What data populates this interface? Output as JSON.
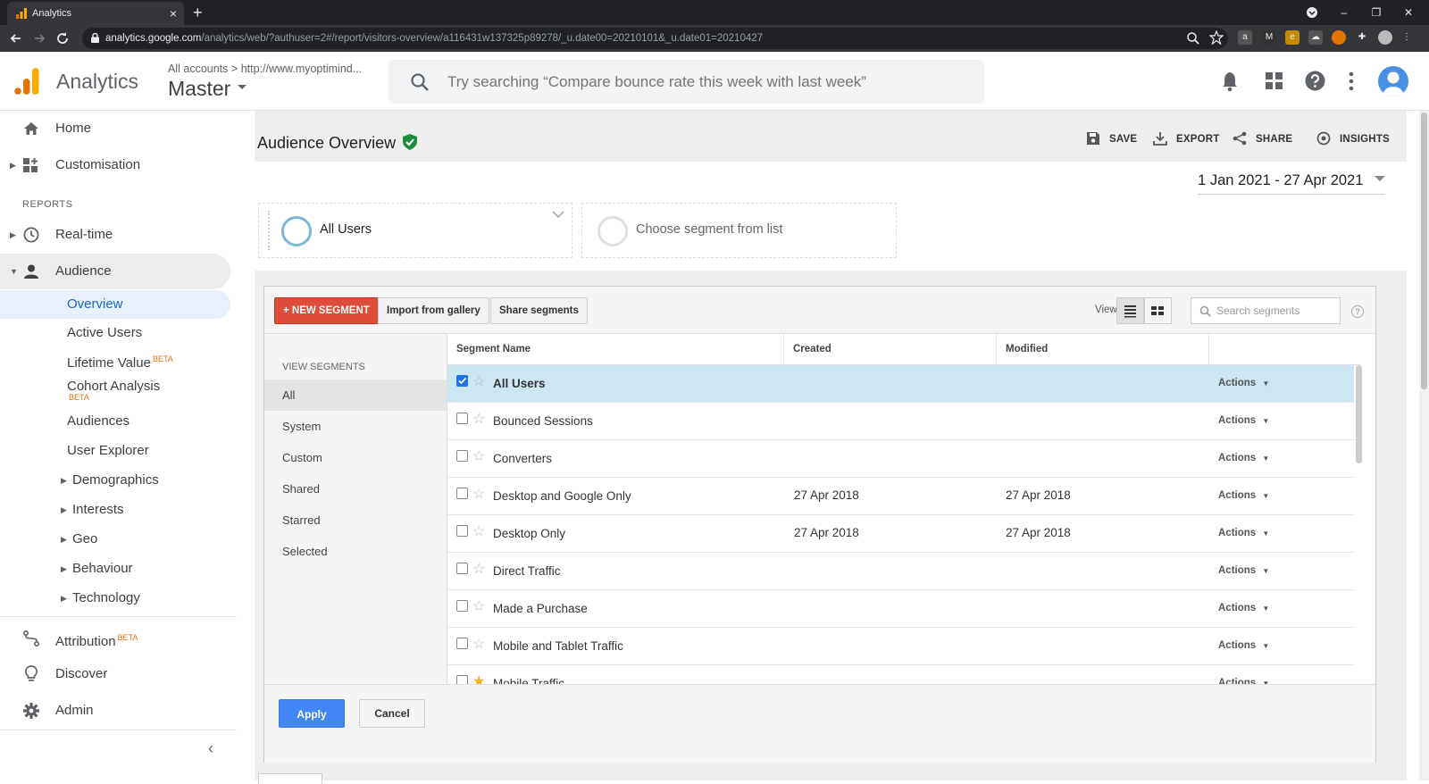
{
  "browser": {
    "tab_title": "Analytics",
    "tab_close": "×",
    "new_tab": "+",
    "url_host": "analytics.google.com",
    "url_path": "/analytics/web/?authuser=2#/report/visitors-overview/a116431w137325p89278/_u.date00=20210101&_u.date01=20210427",
    "window_controls": [
      "–",
      "❐",
      "✕"
    ],
    "nav_icons": [
      "back-arrow-icon",
      "forward-arrow-icon",
      "reload-icon"
    ]
  },
  "header": {
    "app_title": "Analytics",
    "breadcrumb_root": "All accounts",
    "breadcrumb_sep": ">",
    "breadcrumb_property": "http://www.myoptimind...",
    "view_name": "Master",
    "search_placeholder": "Try searching “Compare bounce rate this week with last week”"
  },
  "sidebar": {
    "home": "Home",
    "customisation": "Customisation",
    "reports_header": "REPORTS",
    "realtime": "Real-time",
    "audience": "Audience",
    "audience_items": [
      {
        "label": "Overview",
        "active": true
      },
      {
        "label": "Active Users"
      },
      {
        "label": "Lifetime Value",
        "badge": "BETA"
      },
      {
        "label": "Cohort Analysis",
        "badge": "BETA"
      },
      {
        "label": "Audiences"
      },
      {
        "label": "User Explorer"
      },
      {
        "label": "Demographics",
        "expandable": true
      },
      {
        "label": "Interests",
        "expandable": true
      },
      {
        "label": "Geo",
        "expandable": true
      },
      {
        "label": "Behaviour",
        "expandable": true
      },
      {
        "label": "Technology",
        "expandable": true
      }
    ],
    "attribution": "Attribution",
    "attribution_badge": "BETA",
    "discover": "Discover",
    "admin": "Admin",
    "collapse": "‹"
  },
  "report": {
    "title": "Audience Overview",
    "actions": {
      "save": "SAVE",
      "export": "EXPORT",
      "share": "SHARE",
      "insights": "INSIGHTS"
    },
    "date_range": "1 Jan 2021 - 27 Apr 2021",
    "segment_slot_1": "All Users",
    "segment_slot_2": "Choose segment from list"
  },
  "segment_picker": {
    "new_segment": "+ NEW SEGMENT",
    "import_gallery": "Import from gallery",
    "share_segments": "Share segments",
    "view_label": "View",
    "search_placeholder": "Search segments",
    "help": "?",
    "view_segments_header": "VIEW SEGMENTS",
    "filters": [
      "All",
      "System",
      "Custom",
      "Shared",
      "Starred",
      "Selected"
    ],
    "selected_filter": "All",
    "columns": {
      "name": "Segment Name",
      "created": "Created",
      "modified": "Modified"
    },
    "rows": [
      {
        "name": "All Users",
        "created": "",
        "modified": "",
        "checked": true,
        "starred": false,
        "actions": "Actions"
      },
      {
        "name": "Bounced Sessions",
        "created": "",
        "modified": "",
        "checked": false,
        "starred": false,
        "actions": "Actions"
      },
      {
        "name": "Converters",
        "created": "",
        "modified": "",
        "checked": false,
        "starred": false,
        "actions": "Actions"
      },
      {
        "name": "Desktop and Google Only",
        "created": "27 Apr 2018",
        "modified": "27 Apr 2018",
        "checked": false,
        "starred": false,
        "actions": "Actions"
      },
      {
        "name": "Desktop Only",
        "created": "27 Apr 2018",
        "modified": "27 Apr 2018",
        "checked": false,
        "starred": false,
        "actions": "Actions"
      },
      {
        "name": "Direct Traffic",
        "created": "",
        "modified": "",
        "checked": false,
        "starred": false,
        "actions": "Actions"
      },
      {
        "name": "Made a Purchase",
        "created": "",
        "modified": "",
        "checked": false,
        "starred": false,
        "actions": "Actions"
      },
      {
        "name": "Mobile and Tablet Traffic",
        "created": "",
        "modified": "",
        "checked": false,
        "starred": false,
        "actions": "Actions"
      },
      {
        "name": "Mobile Traffic",
        "created": "",
        "modified": "",
        "checked": false,
        "starred": true,
        "actions": "Actions"
      }
    ],
    "apply": "Apply",
    "cancel": "Cancel"
  },
  "colors": {
    "accent_blue": "#4285f4",
    "new_segment_red": "#dd4b39",
    "selected_row": "#cde6f2",
    "verified_green": "#1e8e3e",
    "ga_orange": "#f9ab00"
  }
}
